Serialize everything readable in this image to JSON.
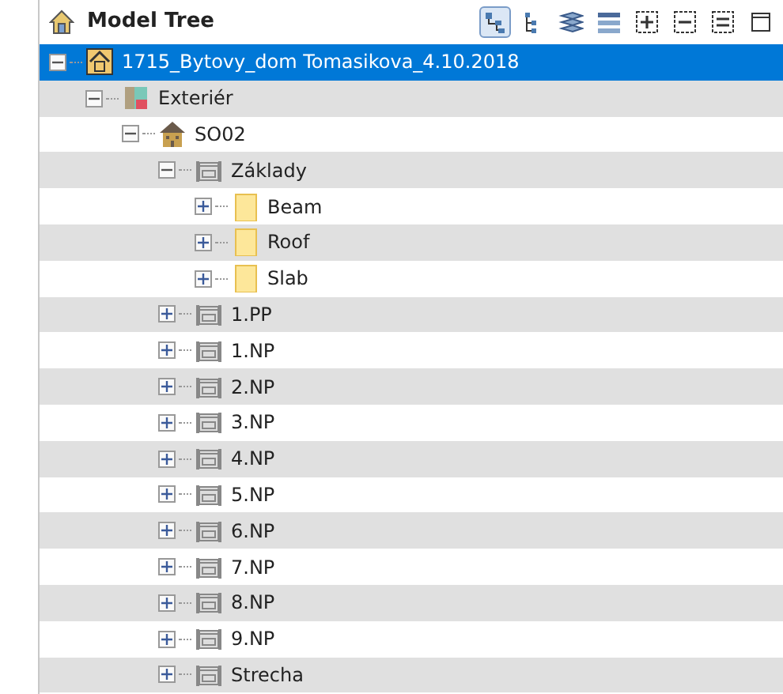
{
  "panel": {
    "title": "Model Tree"
  },
  "toolbar": [
    {
      "kind": "tree",
      "selected": true
    },
    {
      "kind": "list",
      "selected": false
    },
    {
      "kind": "layers",
      "selected": false
    },
    {
      "kind": "grid",
      "selected": false
    },
    {
      "kind": "expand",
      "selected": false
    },
    {
      "kind": "collapse",
      "selected": false
    },
    {
      "kind": "lines",
      "selected": false
    },
    {
      "kind": "window",
      "selected": false
    }
  ],
  "tree": [
    {
      "label": "1715_Bytovy_dom Tomasikova_4.10.2018",
      "kind": "project",
      "expanded": true,
      "selected": true,
      "children": [
        {
          "label": "Exteriér",
          "kind": "exterior",
          "expanded": true,
          "selected": false,
          "children": [
            {
              "label": "SO02",
              "kind": "building",
              "expanded": true,
              "selected": false,
              "children": [
                {
                  "label": "Základy",
                  "kind": "floor",
                  "expanded": true,
                  "selected": false,
                  "children": [
                    {
                      "label": "Beam",
                      "kind": "folder",
                      "expanded": false,
                      "selected": false
                    },
                    {
                      "label": "Roof",
                      "kind": "folder",
                      "expanded": false,
                      "selected": false
                    },
                    {
                      "label": "Slab",
                      "kind": "folder",
                      "expanded": false,
                      "selected": false
                    }
                  ]
                },
                {
                  "label": "1.PP",
                  "kind": "floor",
                  "expanded": false,
                  "selected": false
                },
                {
                  "label": "1.NP",
                  "kind": "floor",
                  "expanded": false,
                  "selected": false
                },
                {
                  "label": "2.NP",
                  "kind": "floor",
                  "expanded": false,
                  "selected": false
                },
                {
                  "label": "3.NP",
                  "kind": "floor",
                  "expanded": false,
                  "selected": false
                },
                {
                  "label": "4.NP",
                  "kind": "floor",
                  "expanded": false,
                  "selected": false
                },
                {
                  "label": "5.NP",
                  "kind": "floor",
                  "expanded": false,
                  "selected": false
                },
                {
                  "label": "6.NP",
                  "kind": "floor",
                  "expanded": false,
                  "selected": false
                },
                {
                  "label": "7.NP",
                  "kind": "floor",
                  "expanded": false,
                  "selected": false
                },
                {
                  "label": "8.NP",
                  "kind": "floor",
                  "expanded": false,
                  "selected": false
                },
                {
                  "label": "9.NP",
                  "kind": "floor",
                  "expanded": false,
                  "selected": false
                },
                {
                  "label": "Strecha",
                  "kind": "floor",
                  "expanded": false,
                  "selected": false
                }
              ]
            }
          ]
        }
      ]
    }
  ]
}
